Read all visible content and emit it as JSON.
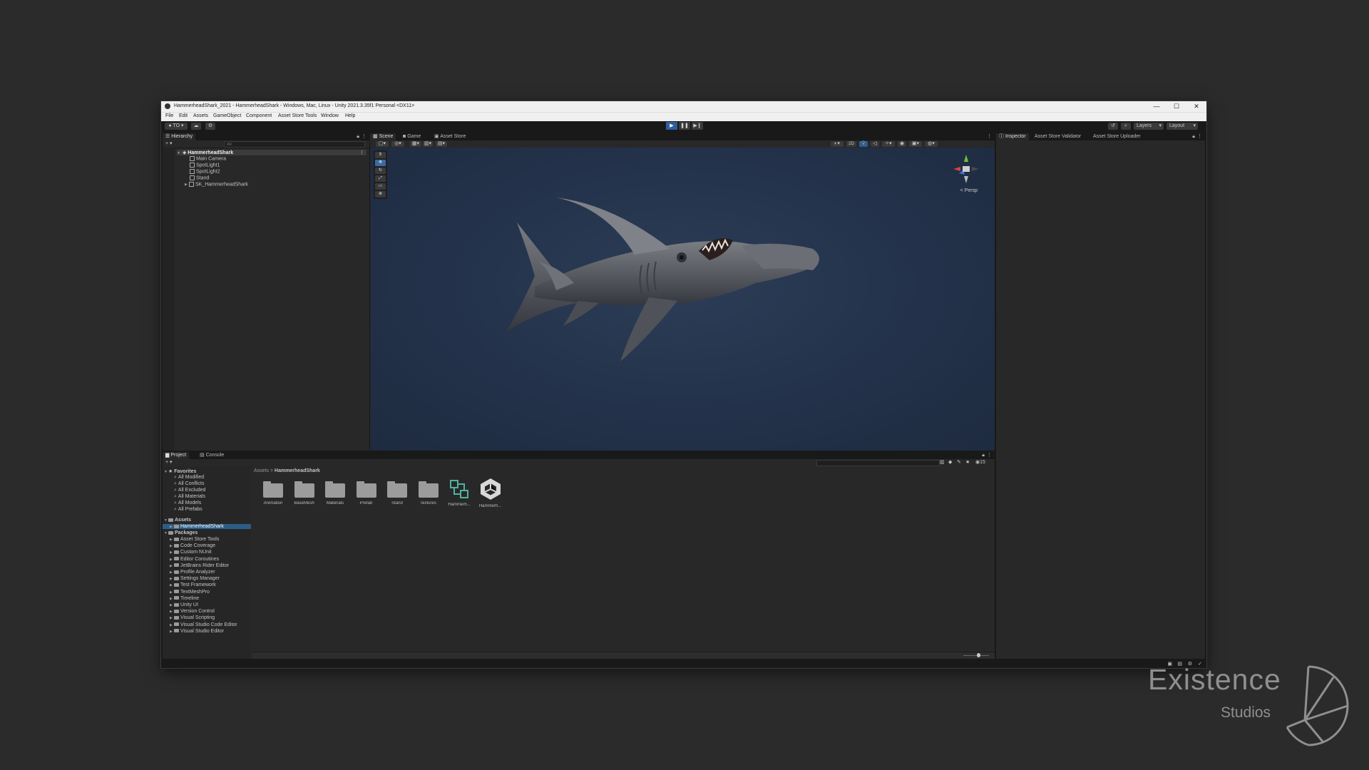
{
  "window": {
    "title": "HammerheadShark_2021 - HammerheadShark - Windows, Mac, Linux - Unity 2021.3.35f1 Personal <DX11>",
    "minimize": "—",
    "maximize": "☐",
    "close": "✕"
  },
  "menu": [
    "File",
    "Edit",
    "Assets",
    "GameObject",
    "Component",
    "Asset Store Tools",
    "Window",
    "Help"
  ],
  "toolbar": {
    "account": "TO",
    "play": "▶",
    "pause": "❚❚",
    "step": "▶❙",
    "layers": "Layers",
    "layout": "Layout"
  },
  "hierarchy": {
    "tab": "Hierarchy",
    "search_placeholder": "All",
    "scene": "HammerheadShark",
    "items": [
      "Main Camera",
      "SpotLight1",
      "SpotLight2",
      "Stand",
      "SK_HammerheadShark"
    ]
  },
  "scene_tabs": [
    "Scene",
    "Game",
    "Asset Store"
  ],
  "scene_view": {
    "persp_label": "< Persp",
    "toggle_2d": "2D"
  },
  "inspector_tabs": [
    "Inspector",
    "Asset Store Validator",
    "Asset Store Uploader"
  ],
  "project": {
    "tabs": [
      "Project",
      "Console"
    ],
    "favorites_header": "Favorites",
    "favorites": [
      "All Modified",
      "All Conflicts",
      "All Excluded",
      "All Materials",
      "All Models",
      "All Prefabs"
    ],
    "assets_header": "Assets",
    "assets_child": "HammerheadShark",
    "packages_header": "Packages",
    "packages": [
      "Asset Store Tools",
      "Code Coverage",
      "Custom NUnit",
      "Editor Coroutines",
      "JetBrains Rider Editor",
      "Profile Analyzer",
      "Settings Manager",
      "Test Framework",
      "TextMeshPro",
      "Timeline",
      "Unity UI",
      "Version Control",
      "Visual Scripting",
      "Visual Studio Code Editor",
      "Visual Studio Editor"
    ],
    "breadcrumb_root": "Assets",
    "breadcrumb_sep": ">",
    "breadcrumb_current": "HammerheadShark",
    "hidden_count": "15",
    "grid": [
      {
        "label": "Animation",
        "kind": "folder"
      },
      {
        "label": "BaseMesh",
        "kind": "folder"
      },
      {
        "label": "Materials",
        "kind": "folder"
      },
      {
        "label": "Prefab",
        "kind": "folder"
      },
      {
        "label": "Stand",
        "kind": "folder"
      },
      {
        "label": "Textures",
        "kind": "folder"
      },
      {
        "label": "Hammerh...",
        "kind": "prefab"
      },
      {
        "label": "Hammerh...",
        "kind": "unity-scene"
      }
    ]
  },
  "watermark": {
    "line1": "Existence",
    "line2": "Studios"
  }
}
